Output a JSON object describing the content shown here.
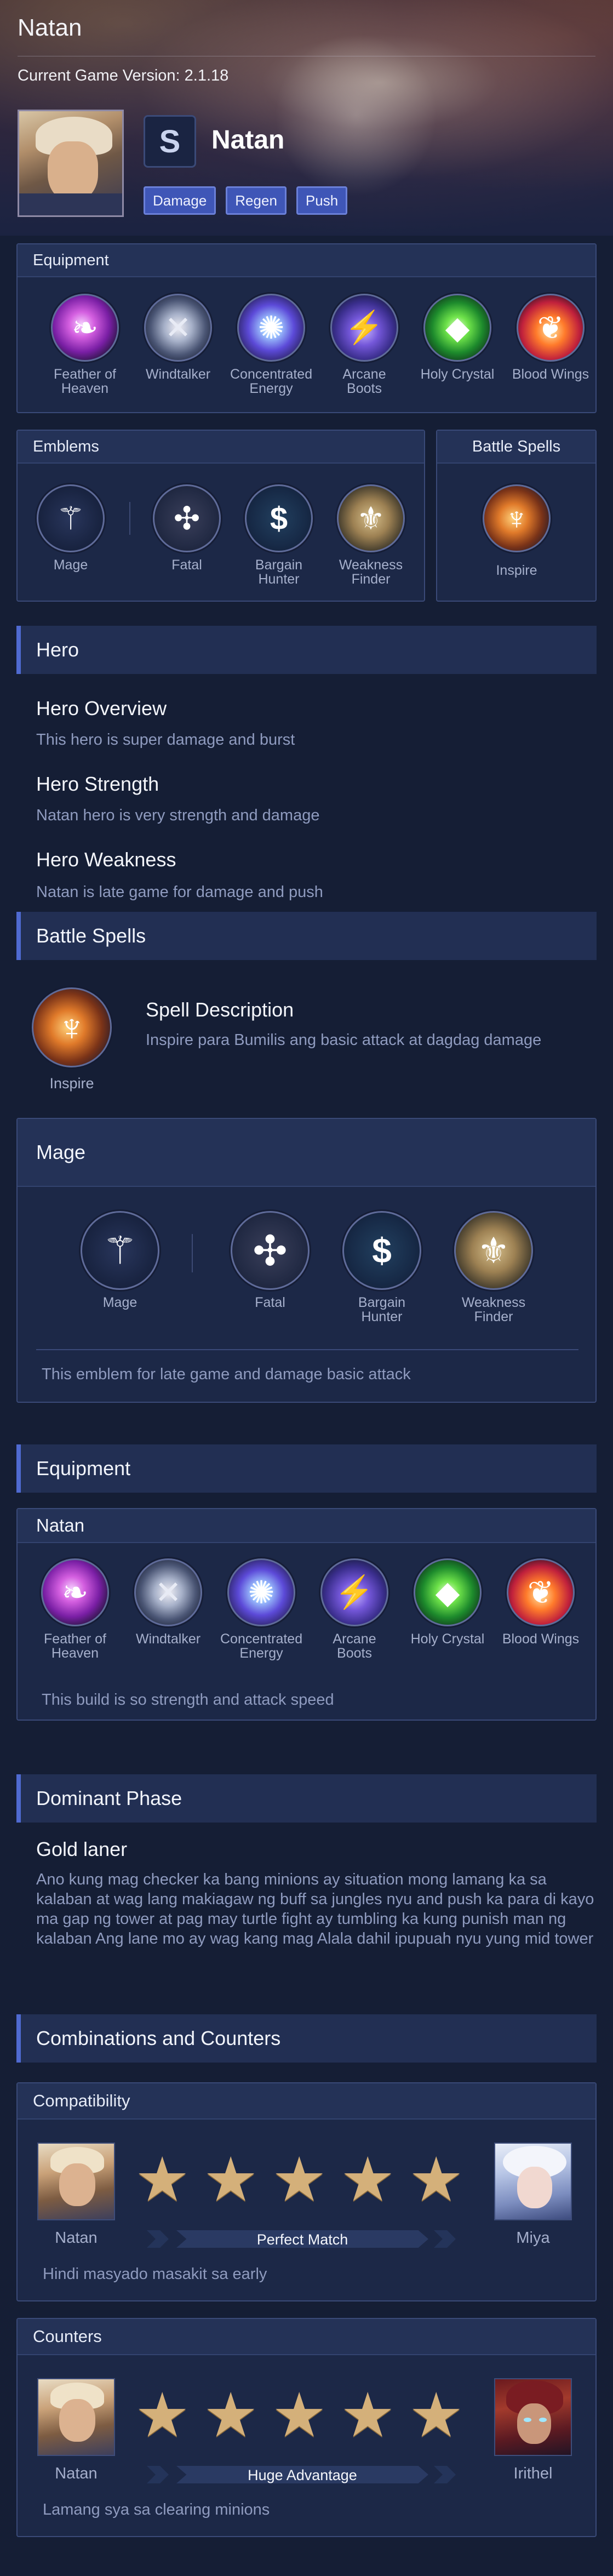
{
  "page": {
    "title": "Natan",
    "version_label": "Current Game Version: 2.1.18"
  },
  "hero": {
    "name": "Natan",
    "role_icon": "S",
    "tags": [
      "Damage",
      "Regen",
      "Push"
    ]
  },
  "equipment_panel": {
    "title": "Equipment",
    "items": [
      {
        "name": "Feather of\nHeaven",
        "icon": "feather-icon"
      },
      {
        "name": "Windtalker",
        "icon": "windtalker-icon"
      },
      {
        "name": "Concentrated\nEnergy",
        "icon": "energy-icon"
      },
      {
        "name": "Arcane Boots",
        "icon": "boots-icon"
      },
      {
        "name": "Holy Crystal",
        "icon": "crystal-icon"
      },
      {
        "name": "Blood Wings",
        "icon": "wings-icon"
      }
    ]
  },
  "emblems_panel": {
    "title": "Emblems",
    "main": {
      "name": "Mage",
      "icon": "mage-icon"
    },
    "talents": [
      {
        "name": "Fatal",
        "icon": "fatal-icon"
      },
      {
        "name": "Bargain\nHunter",
        "icon": "bargain-icon"
      },
      {
        "name": "Weakness\nFinder",
        "icon": "weakness-icon"
      }
    ]
  },
  "spells_panel": {
    "title": "Battle Spells",
    "spell": {
      "name": "Inspire",
      "icon": "inspire-icon"
    }
  },
  "hero_section": {
    "title": "Hero",
    "overview_title": "Hero Overview",
    "overview_text": "This hero is super damage and burst",
    "strength_title": "Hero Strength",
    "strength_text": "Natan hero is very strength and damage",
    "weakness_title": "Hero Weakness",
    "weakness_text": "Natan is late game for damage and push"
  },
  "battle_spells_section": {
    "title": "Battle Spells",
    "spell_name": "Inspire",
    "desc_title": "Spell Description",
    "desc_text": "Inspire para Bumilis ang basic attack at dagdag damage"
  },
  "mage_section": {
    "title": "Mage",
    "main": "Mage",
    "talents": [
      "Fatal",
      "Bargain\nHunter",
      "Weakness\nFinder"
    ],
    "note": "This emblem for late game and damage basic attack"
  },
  "equipment_section": {
    "title": "Equipment",
    "build_title": "Natan",
    "items": [
      "Feather of\nHeaven",
      "Windtalker",
      "Concentrated\nEnergy",
      "Arcane\nBoots",
      "Holy Crystal",
      "Blood Wings"
    ],
    "note": "This build is so strength and attack speed"
  },
  "dominant_section": {
    "title": "Dominant Phase",
    "phase": "Gold laner",
    "text": "Ano kung mag checker ka bang minions ay situation mong lamang ka sa kalaban at wag lang makiagaw ng buff sa jungles nyu and push ka para di kayo ma gap ng tower at pag may turtle fight ay tumbling ka kung punish man ng kalaban Ang lane mo ay wag kang mag Alala dahil ipupuah nyu yung mid tower"
  },
  "combos_section": {
    "title": "Combinations and Counters",
    "compat": {
      "title": "Compatibility",
      "left": "Natan",
      "right": "Miya",
      "rating": 5,
      "label": "Perfect Match",
      "note": "Hindi masyado masakit sa early"
    },
    "counters": {
      "title": "Counters",
      "left": "Natan",
      "right": "Irithel",
      "rating": 5,
      "label": "Huge Advantage",
      "note": "Lamang sya sa clearing minions"
    }
  },
  "colors": {
    "accent": "#4f6ad1",
    "tag_bg": "#3f56b7",
    "star": "#d4b07a",
    "panel": "#1c2847"
  }
}
